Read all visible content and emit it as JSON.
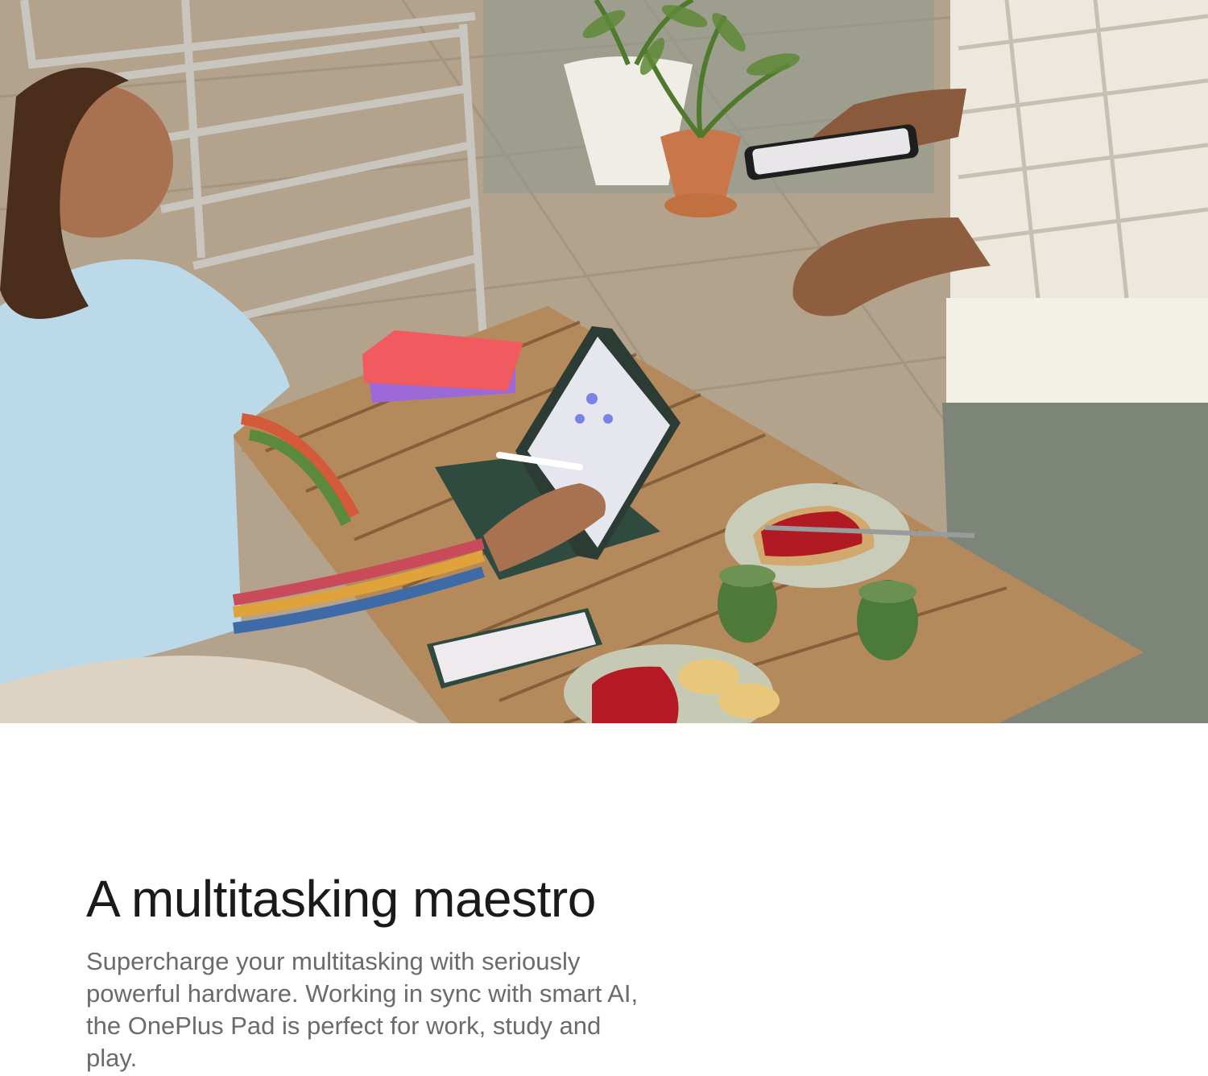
{
  "feature": {
    "headline": "A multitasking maestro",
    "description": "Supercharge your multitasking with seriously powerful hardware. Working in sync with smart AI, the OnePlus Pad is perfect for work, study and play."
  },
  "colors": {
    "headline": "#1a1a1a",
    "body": "#6b6b6b",
    "background": "#ffffff"
  }
}
